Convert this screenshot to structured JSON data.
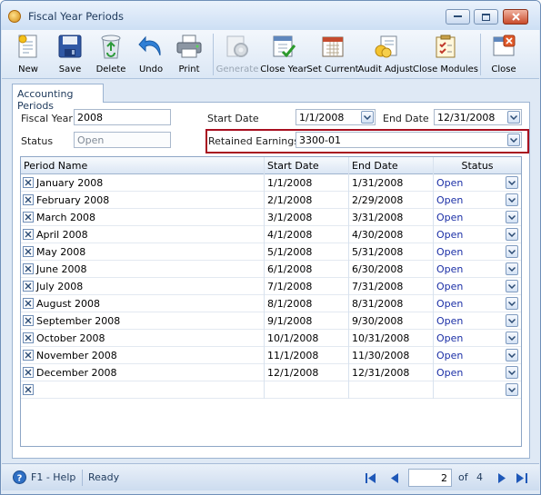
{
  "window": {
    "title": "Fiscal Year Periods"
  },
  "toolbar": {
    "buttons": [
      {
        "label": "New"
      },
      {
        "label": "Save"
      },
      {
        "label": "Delete"
      },
      {
        "label": "Undo"
      },
      {
        "label": "Print"
      },
      {
        "label": "Generate",
        "disabled": true
      },
      {
        "label": "Close Year"
      },
      {
        "label": "Set Current"
      },
      {
        "label": "Audit Adjust"
      },
      {
        "label": "Close Modules"
      },
      {
        "label": "Close"
      }
    ]
  },
  "tab": {
    "label": "Accounting Periods"
  },
  "form": {
    "fiscal_year_label": "Fiscal Year",
    "fiscal_year": "2008",
    "status_label": "Status",
    "status": "Open",
    "start_date_label": "Start Date",
    "start_date": "1/1/2008",
    "end_date_label": "End Date",
    "end_date": "12/31/2008",
    "retained_earnings_label": "Retained Earnings",
    "retained_earnings": "3300-01"
  },
  "grid": {
    "columns": [
      "Period Name",
      "Start Date",
      "End Date",
      "Status"
    ],
    "rows": [
      {
        "name": "January 2008",
        "start": "1/1/2008",
        "end": "1/31/2008",
        "status": "Open"
      },
      {
        "name": "February 2008",
        "start": "2/1/2008",
        "end": "2/29/2008",
        "status": "Open"
      },
      {
        "name": "March 2008",
        "start": "3/1/2008",
        "end": "3/31/2008",
        "status": "Open"
      },
      {
        "name": "April 2008",
        "start": "4/1/2008",
        "end": "4/30/2008",
        "status": "Open"
      },
      {
        "name": "May 2008",
        "start": "5/1/2008",
        "end": "5/31/2008",
        "status": "Open"
      },
      {
        "name": "June 2008",
        "start": "6/1/2008",
        "end": "6/30/2008",
        "status": "Open"
      },
      {
        "name": "July 2008",
        "start": "7/1/2008",
        "end": "7/31/2008",
        "status": "Open"
      },
      {
        "name": "August 2008",
        "start": "8/1/2008",
        "end": "8/31/2008",
        "status": "Open"
      },
      {
        "name": "September 2008",
        "start": "9/1/2008",
        "end": "9/30/2008",
        "status": "Open"
      },
      {
        "name": "October 2008",
        "start": "10/1/2008",
        "end": "10/31/2008",
        "status": "Open"
      },
      {
        "name": "November 2008",
        "start": "11/1/2008",
        "end": "11/30/2008",
        "status": "Open"
      },
      {
        "name": "December 2008",
        "start": "12/1/2008",
        "end": "12/31/2008",
        "status": "Open"
      },
      {
        "name": "",
        "start": "",
        "end": "",
        "status": ""
      }
    ]
  },
  "statusbar": {
    "help": "F1 - Help",
    "state": "Ready",
    "page": "2",
    "of_label": "of",
    "total_pages": "4"
  },
  "colors": {
    "accent_border": "#a80e1f",
    "link": "#1b2fa6"
  }
}
